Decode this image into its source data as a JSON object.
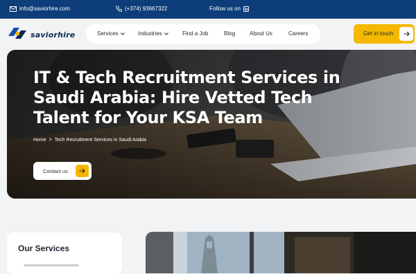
{
  "topbar": {
    "email": "info@saviorhire.com",
    "phone": "(+374) 93667322",
    "follow_label": "Follow us on"
  },
  "header": {
    "brand": "saviorhire",
    "nav": [
      {
        "label": "Services",
        "dropdown": true
      },
      {
        "label": "Industries",
        "dropdown": true
      },
      {
        "label": "Find a Job",
        "dropdown": false
      },
      {
        "label": "Blog",
        "dropdown": false
      },
      {
        "label": "About Us",
        "dropdown": false
      },
      {
        "label": "Careers",
        "dropdown": false
      }
    ],
    "cta_label": "Get in touch"
  },
  "hero": {
    "title": "IT & Tech Recruitment Services in Saudi Arabia: Hire Vetted Tech Talent for Your KSA Team",
    "breadcrumb": {
      "home": "Home",
      "separator": ">",
      "current": "Tech Recruitment Services in Saudi Arabia"
    },
    "button_label": "Contact us"
  },
  "sidebar": {
    "title": "Our Services"
  },
  "colors": {
    "topbar": "#0d3e7a",
    "accent": "#f5b800",
    "page_bg": "#f2f3f5",
    "text_dark": "#1e2430"
  },
  "icons": [
    "envelope-icon",
    "phone-icon",
    "linkedin-icon",
    "chevron-down-icon",
    "arrow-right-icon",
    "logo-mark-icon"
  ]
}
